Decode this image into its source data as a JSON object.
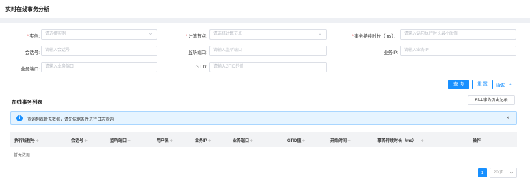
{
  "page": {
    "title": "实时在线事务分析"
  },
  "filters": {
    "instance": {
      "label": "实例:",
      "required": true,
      "placeholder": "请选择实例"
    },
    "compute_node": {
      "label": "计算节点:",
      "required": true,
      "placeholder": "请选择计算节点"
    },
    "txn_duration": {
      "label": "事务持续时长（ms）：",
      "required": true,
      "placeholder": "请输入语句执行时长最小阈值"
    },
    "session_id": {
      "label": "会话号:",
      "placeholder": "请输入会话号"
    },
    "listen_port": {
      "label": "监听端口:",
      "placeholder": "请输入监听端口"
    },
    "biz_ip": {
      "label": "业务IP:",
      "placeholder": "请输入业务IP"
    },
    "biz_port": {
      "label": "业务端口:",
      "placeholder": "请输入业务端口"
    },
    "gtid": {
      "label": "GTID:",
      "placeholder": "请输入GTID的值"
    }
  },
  "actions": {
    "query": "查 询",
    "reset": "重 置",
    "collapse": "收起",
    "collapse_icon": "^"
  },
  "list": {
    "title": "在线事务列表",
    "kill_history": "KILL事务历史记录",
    "alert_text": "查询列表暂无数据，请先依据条件进行日志查询",
    "alert_icon": "info-icon",
    "alert_close": "×",
    "columns": [
      "执行线程号",
      "会话号",
      "监听端口",
      "用户名",
      "业务IP",
      "业务端口",
      "GTID值",
      "开始时间",
      "事务持续时长（ms）",
      "操作"
    ],
    "empty_text": "暂无数据"
  },
  "pagination": {
    "current_page": "1",
    "page_size": "20/页"
  },
  "colors": {
    "primary": "#1890ff",
    "required": "#e54545",
    "alert_bg": "#e6f4ff"
  }
}
